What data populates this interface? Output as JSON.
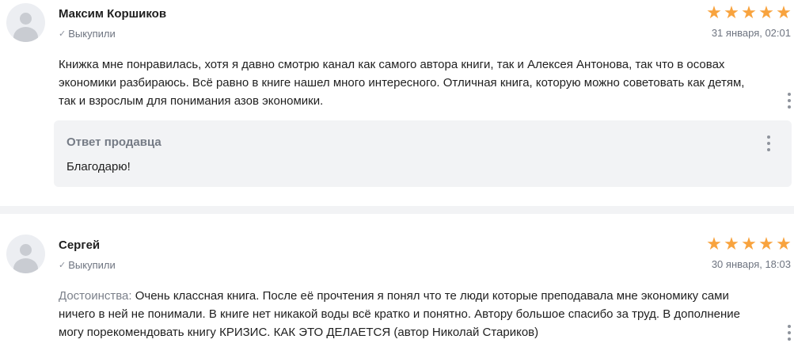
{
  "reviews": [
    {
      "author": "Максим Коршиков",
      "bought_label": "Выкупили",
      "date": "31 января, 02:01",
      "rating": 5,
      "text": "Книжка мне понравилась, хотя я давно смотрю канал как самого автора книги, так и Алексея Антонова, так что в осовах экономики разбираюсь. Всё равно в книге нашел много интересного. Отличная книга, которую можно советовать как детям, так и взрослым для понимания азов экономики.",
      "seller_reply": {
        "title": "Ответ продавца",
        "text": "Благодарю!"
      }
    },
    {
      "author": "Сергей",
      "bought_label": "Выкупили",
      "date": "30 января, 18:03",
      "rating": 5,
      "advantages_label": "Достоинства:",
      "text": "Очень классная книга. После её прочтения я понял что те люди которые преподавала мне экономику сами ничего в ней не понимали. В книге нет никакой воды всё кратко и понятно. Автору большое спасибо за труд. В дополнение могу порекомендовать книгу КРИЗИС. КАК ЭТО ДЕЛАЕТСЯ (автор Николай Стариков)"
    }
  ],
  "icons": {
    "star": "star-icon",
    "check": "check-icon",
    "more": "more-vertical-icon",
    "avatar": "user-avatar-icon"
  },
  "colors": {
    "star": "#f8a33e",
    "muted_text": "#6e7480",
    "reply_background": "#f2f3f5"
  }
}
